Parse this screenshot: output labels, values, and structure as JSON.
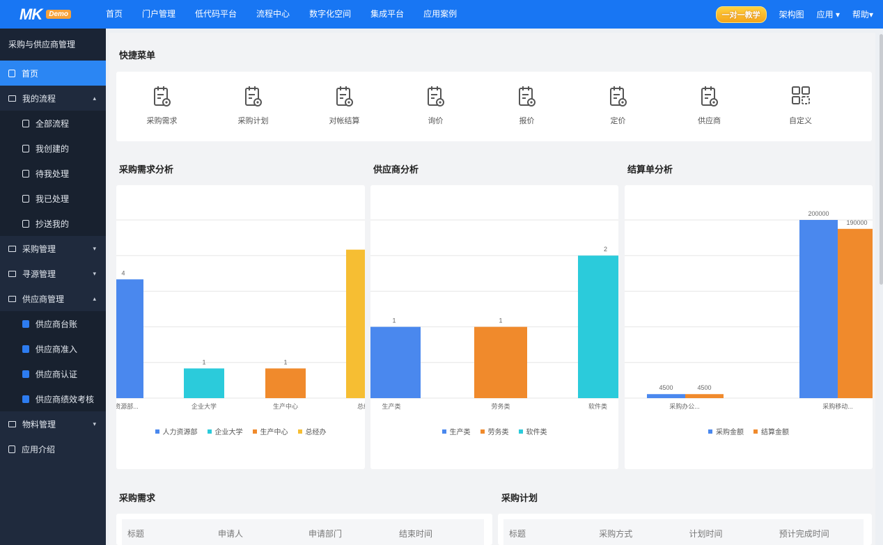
{
  "logo": {
    "mark": "MK",
    "badge": "Demo"
  },
  "nav": [
    "首页",
    "门户管理",
    "低代码平台",
    "流程中心",
    "数字化空间",
    "集成平台",
    "应用案例"
  ],
  "top_right": {
    "promo": "一对一教学",
    "org": "架构图",
    "app": "应用 ▾",
    "help": "帮助▾"
  },
  "sidebar": {
    "title": "采购与供应商管理",
    "items": [
      {
        "label": "首页"
      },
      {
        "label": "我的流程",
        "arrow": "▴"
      },
      {
        "label": "全部流程"
      },
      {
        "label": "我创建的"
      },
      {
        "label": "待我处理"
      },
      {
        "label": "我已处理"
      },
      {
        "label": "抄送我的"
      },
      {
        "label": "采购管理",
        "arrow": "▾"
      },
      {
        "label": "寻源管理",
        "arrow": "▾"
      },
      {
        "label": "供应商管理",
        "arrow": "▴"
      },
      {
        "label": "供应商台账"
      },
      {
        "label": "供应商准入"
      },
      {
        "label": "供应商认证"
      },
      {
        "label": "供应商绩效考核"
      },
      {
        "label": "物料管理",
        "arrow": "▾"
      },
      {
        "label": "应用介绍"
      }
    ]
  },
  "quick": {
    "title": "快捷菜单",
    "items": [
      "采购需求",
      "采购计划",
      "对帐结算",
      "询价",
      "报价",
      "定价",
      "供应商",
      "自定义"
    ]
  },
  "sections": {
    "demand_analysis": "采购需求分析",
    "supplier_analysis": "供应商分析",
    "settlement_analysis": "结算单分析",
    "demand": "采购需求",
    "plan": "采购计划"
  },
  "tables": {
    "demand_cols": [
      "标题",
      "申请人",
      "申请部门",
      "结束时间"
    ],
    "plan_cols": [
      "标题",
      "采购方式",
      "计划时间",
      "预计完成时间"
    ]
  },
  "colors": {
    "blue": "#4a88ee",
    "cyan": "#2bcbdb",
    "orange": "#f08a2c",
    "yellow": "#f6be33"
  },
  "chart_data": [
    {
      "type": "bar",
      "categories": [
        "力资源部...",
        "企业大学",
        "生产中心",
        "总经"
      ],
      "series": [
        {
          "values": [
            4,
            1,
            1,
            5
          ]
        }
      ],
      "value_labels": [
        "4",
        "1",
        "1",
        ""
      ],
      "ylim": [
        0,
        6
      ],
      "legend": [
        "人力资源部",
        "企业大学",
        "生产中心",
        "总经办"
      ],
      "legend_position": "bottom"
    },
    {
      "type": "bar",
      "categories": [
        "生产类",
        "劳务类",
        "软件类"
      ],
      "series": [
        {
          "values": [
            1,
            1,
            2
          ]
        }
      ],
      "value_labels": [
        "1",
        "1",
        "2"
      ],
      "ylim": [
        0,
        3
      ],
      "legend": [
        "生产类",
        "劳务类",
        "软件类"
      ],
      "legend_position": "bottom"
    },
    {
      "type": "bar",
      "categories": [
        "采购办公...",
        "采购移动..."
      ],
      "series": [
        {
          "name": "采购金额",
          "values": [
            4500,
            200000
          ]
        },
        {
          "name": "结算金额",
          "values": [
            4500,
            190000
          ]
        }
      ],
      "ylim": [
        0,
        300000
      ],
      "legend_position": "bottom"
    }
  ]
}
